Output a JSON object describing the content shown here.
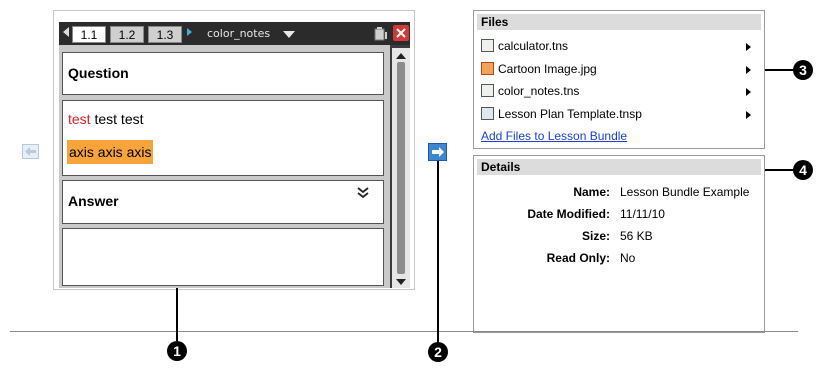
{
  "document": {
    "tabs": [
      "1.1",
      "1.2",
      "1.3"
    ],
    "active_tab": "1.1",
    "doc_name": "color_notes",
    "question_label": "Question",
    "question_text_red": "test",
    "question_text_rest": " test test",
    "highlight_text": "axis axis axis",
    "answer_label": "Answer",
    "colors": {
      "red_text": "#e02020",
      "highlight": "#f7a53a",
      "close": "#d23a3a"
    }
  },
  "files_panel": {
    "title": "Files",
    "items": [
      {
        "name": "calculator.tns",
        "icon": "tns-file-icon"
      },
      {
        "name": "Cartoon Image.jpg",
        "icon": "image-file-icon"
      },
      {
        "name": "color_notes.tns",
        "icon": "tns-file-icon"
      },
      {
        "name": "Lesson Plan Template.tnsp",
        "icon": "template-file-icon"
      }
    ],
    "add_link": "Add Files to Lesson Bundle"
  },
  "details_panel": {
    "title": "Details",
    "rows": [
      {
        "label": "Name:",
        "value": "Lesson Bundle Example"
      },
      {
        "label": "Date Modified:",
        "value": "11/11/10"
      },
      {
        "label": "Size:",
        "value": "56 KB"
      },
      {
        "label": "Read Only:",
        "value": "No"
      }
    ]
  },
  "callouts": [
    "1",
    "2",
    "3",
    "4"
  ]
}
